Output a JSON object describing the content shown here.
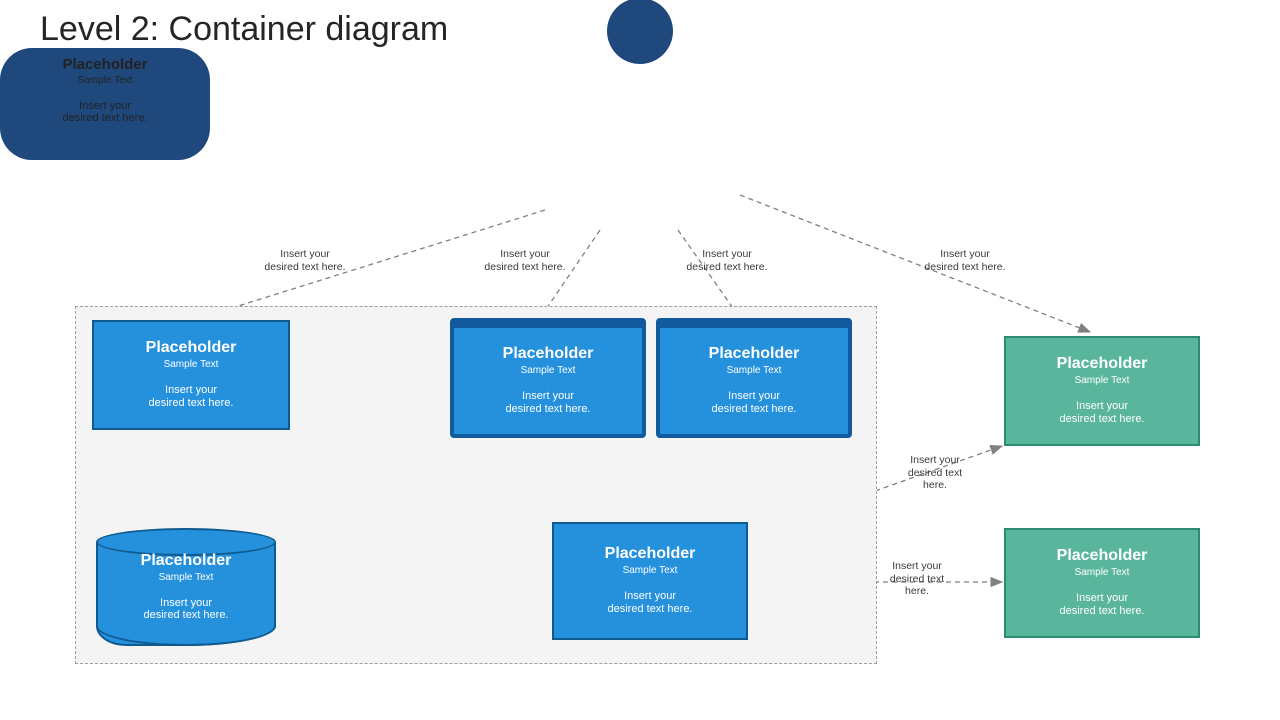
{
  "title": "Level 2: Container diagram",
  "placeholder": {
    "heading": "Placeholder",
    "sub": "Sample Text",
    "body_l1": "Insert your",
    "body_l2": "desired text here."
  },
  "edge": {
    "l1": "Insert your",
    "l2": "desired text here.",
    "l2b": "desired text",
    "l3b": "here."
  },
  "nodes": {
    "person": {
      "role": "actor"
    },
    "box1": {
      "role": "container-rect"
    },
    "box2": {
      "role": "container-device"
    },
    "box3": {
      "role": "container-device"
    },
    "api": {
      "role": "container-rect"
    },
    "db": {
      "role": "database"
    },
    "ext1": {
      "role": "external"
    },
    "ext2": {
      "role": "external"
    }
  },
  "colors": {
    "person": "#1f497d",
    "container": "#2591dd",
    "containerBorder": "#0f5a8f",
    "external": "#59b59c",
    "externalBorder": "#2f8a72",
    "boundary": "#9aa0a6",
    "arrow": "#808080"
  }
}
